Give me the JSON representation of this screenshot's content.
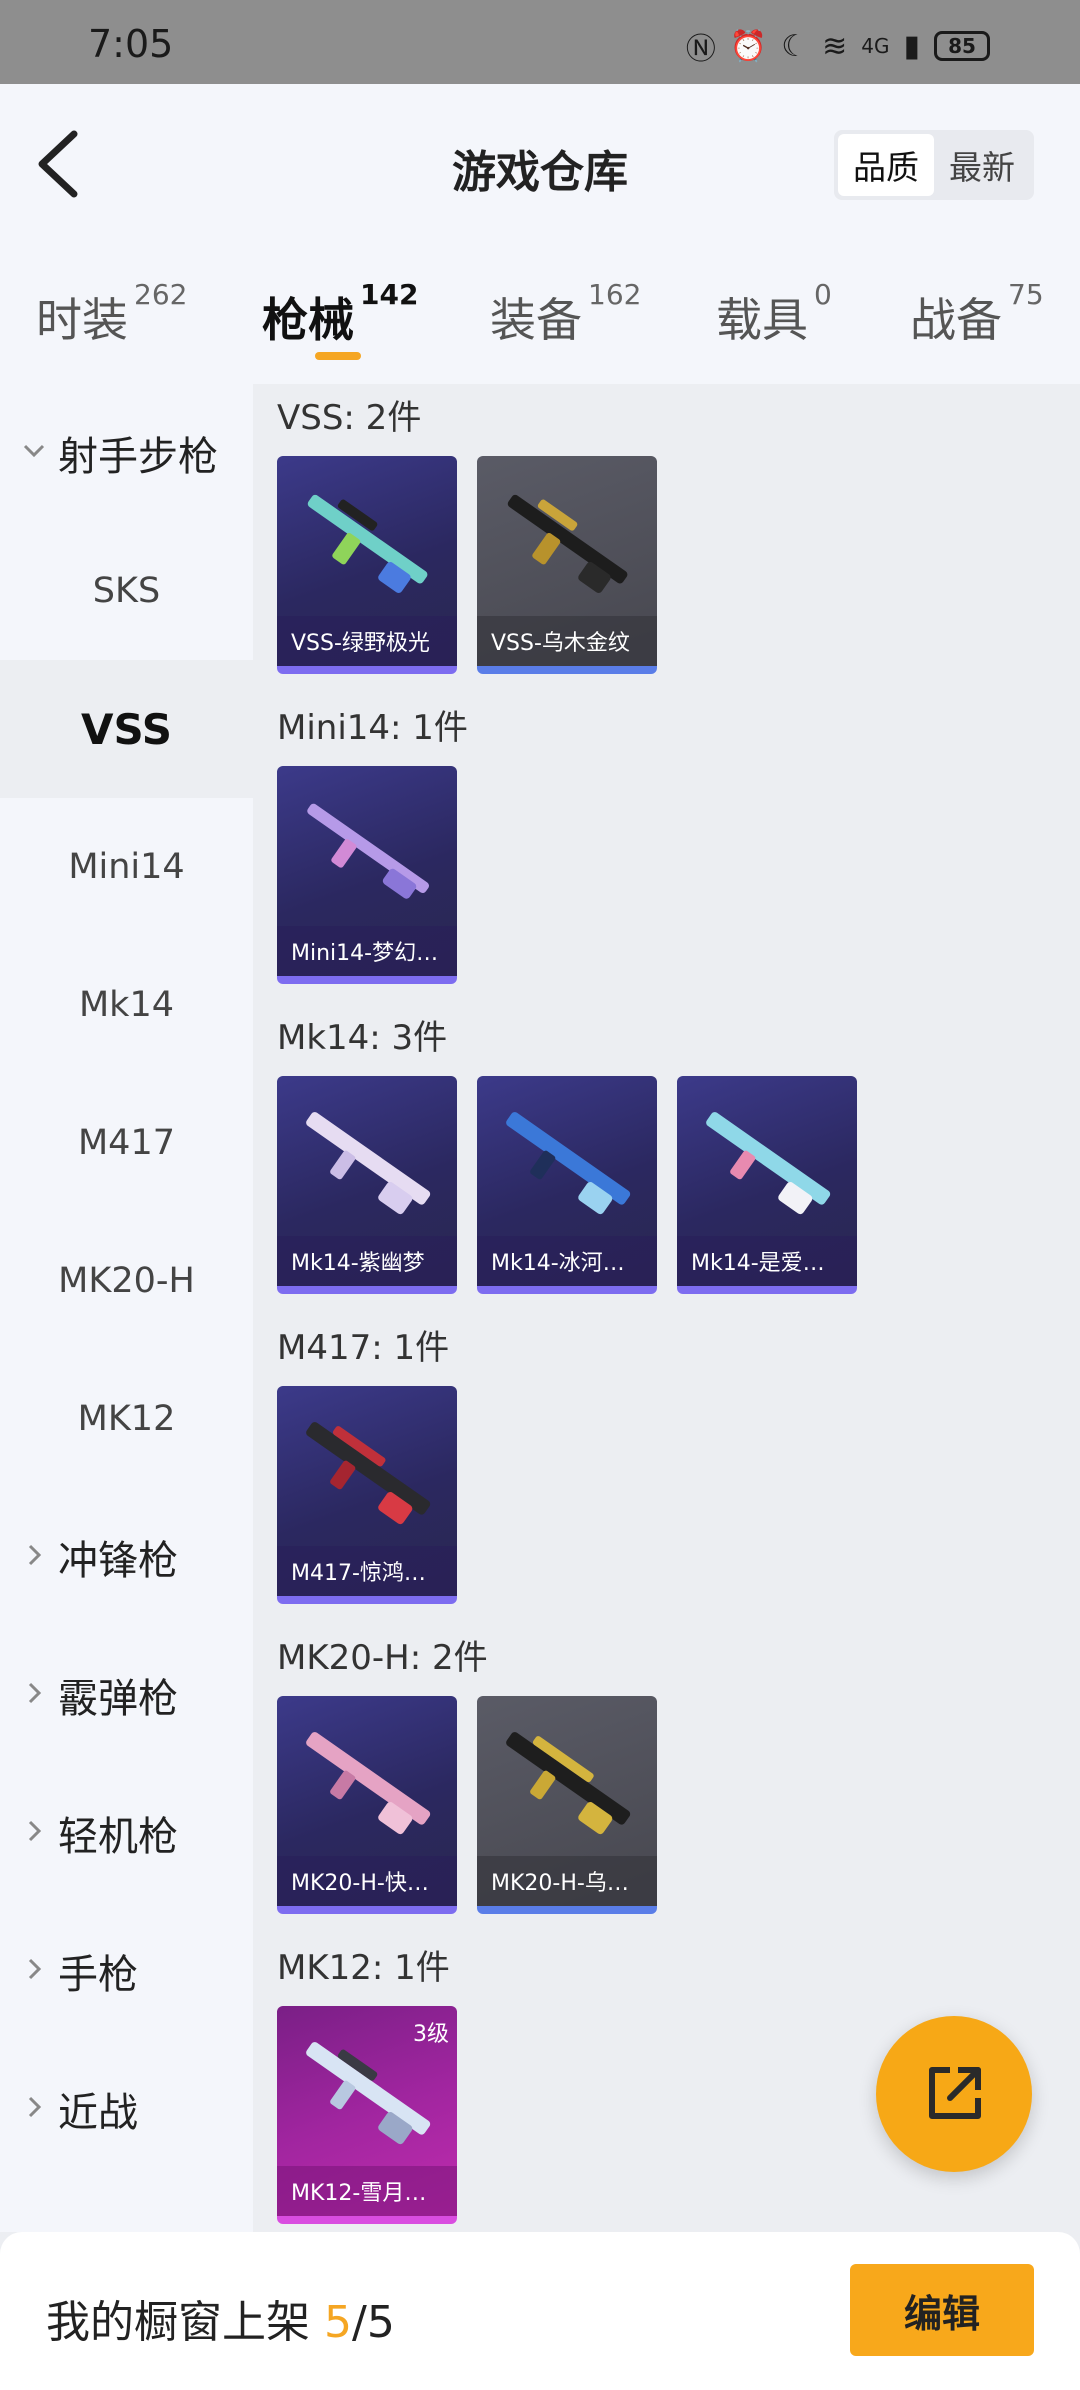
{
  "status": {
    "time": "7:05",
    "icons": [
      "nfc-icon",
      "alarm-icon",
      "moon-icon",
      "wifi-icon",
      "signal-icon",
      "signal-icon"
    ],
    "battery": "85",
    "net": "4G"
  },
  "header": {
    "title": "游戏仓库",
    "sort_quality": "品质",
    "sort_latest": "最新"
  },
  "tabs": [
    {
      "label": "时装",
      "count": "262"
    },
    {
      "label": "枪械",
      "count": "142"
    },
    {
      "label": "装备",
      "count": "162"
    },
    {
      "label": "载具",
      "count": "0"
    },
    {
      "label": "战备",
      "count": "75"
    }
  ],
  "sidebar": {
    "group_open": "射手步枪",
    "items": [
      "SKS",
      "VSS",
      "Mini14",
      "Mk14",
      "M417",
      "MK20-H",
      "MK12"
    ],
    "groups": [
      "冲锋枪",
      "霰弹枪",
      "轻机枪",
      "手枪",
      "近战"
    ]
  },
  "sections": [
    {
      "title": "VSS: 2件",
      "cards": [
        {
          "label": "VSS-绿野极光",
          "style": "purple"
        },
        {
          "label": "VSS-乌木金纹",
          "style": "gray"
        }
      ]
    },
    {
      "title": "Mini14: 1件",
      "cards": [
        {
          "label": "Mini14-梦幻…",
          "style": "purple"
        }
      ]
    },
    {
      "title": "Mk14: 3件",
      "cards": [
        {
          "label": "Mk14-紫幽梦",
          "style": "purple"
        },
        {
          "label": "Mk14-冰河…",
          "style": "purple"
        },
        {
          "label": "Mk14-是爱…",
          "style": "purple"
        }
      ]
    },
    {
      "title": "M417: 1件",
      "cards": [
        {
          "label": "M417-惊鸿…",
          "style": "purple"
        }
      ]
    },
    {
      "title": "MK20-H: 2件",
      "cards": [
        {
          "label": "MK20-H-快…",
          "style": "purple"
        },
        {
          "label": "MK20-H-乌…",
          "style": "gray"
        }
      ]
    },
    {
      "title": "MK12: 1件",
      "cards": [
        {
          "label": "MK12-雪月…",
          "style": "magenta",
          "badge": "3级"
        }
      ]
    }
  ],
  "bottom": {
    "showcase_label": "我的橱窗上架",
    "showcase_current": "5",
    "showcase_total": "/5",
    "edit_label": "编辑"
  },
  "colors": {
    "accent": "#f5a623",
    "purple_card": "#2b2860",
    "gray_card": "#47474f",
    "magenta_card": "#a0259f"
  }
}
